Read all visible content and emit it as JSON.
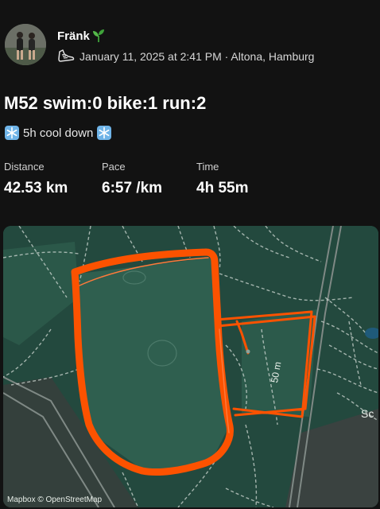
{
  "activity": {
    "user_name": "Fränk",
    "activity_icon": "running-shoe-icon",
    "date_location": "January 11, 2025 at 2:41 PM · Altona, Hamburg",
    "title": "M52 swim:0 bike:1 run:2",
    "description": "5h cool down",
    "description_icon": "snowflake-icon"
  },
  "stats": [
    {
      "label": "Distance",
      "value": "42.53 km"
    },
    {
      "label": "Pace",
      "value": "6:57 /km"
    },
    {
      "label": "Time",
      "value": "4h 55m"
    }
  ],
  "map": {
    "road_label": "50 m",
    "place_label": "Sc",
    "attribution": "Mapbox © OpenStreetMap",
    "route_color": "#fc5200",
    "park_color": "#2f5f4f",
    "land_color": "#23493e",
    "road_color": "#cfd8d3"
  }
}
